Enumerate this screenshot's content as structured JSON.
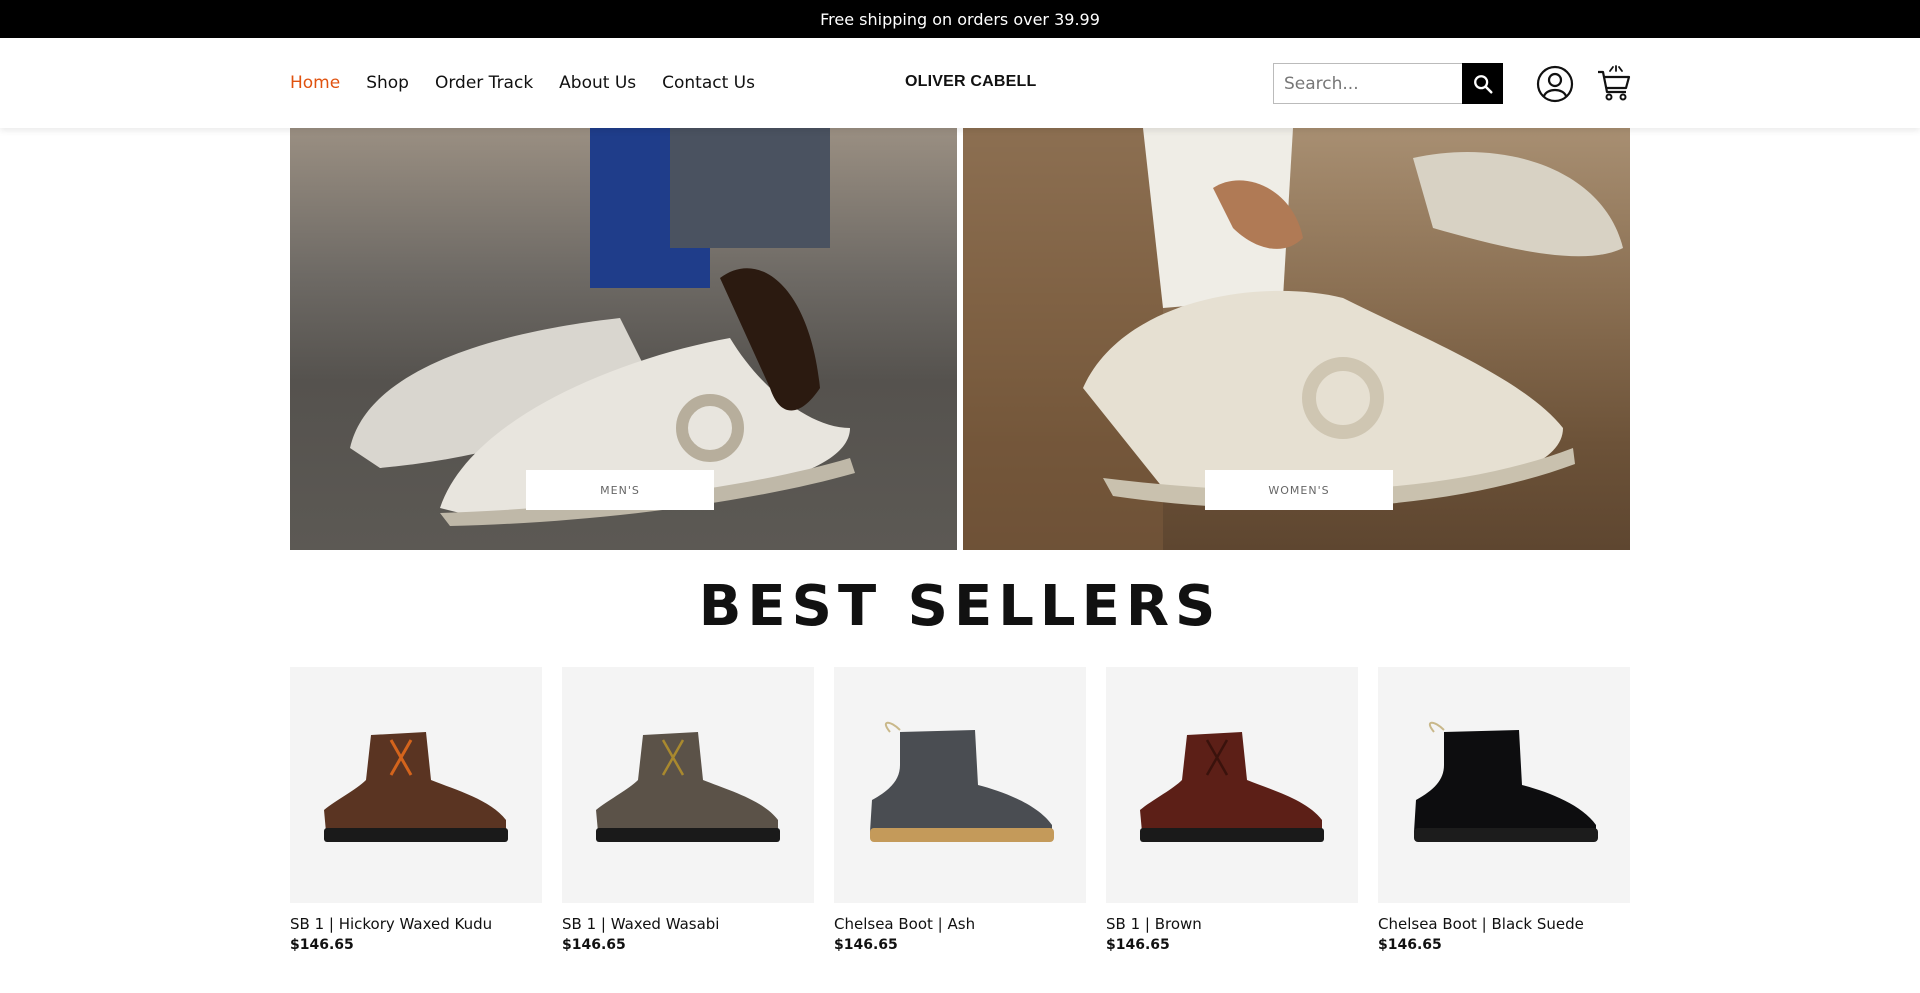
{
  "topbar": {
    "text": "Free shipping on orders over 39.99"
  },
  "nav": [
    {
      "label": "Home",
      "active": true
    },
    {
      "label": "Shop"
    },
    {
      "label": "Order Track"
    },
    {
      "label": "About Us"
    },
    {
      "label": "Contact Us"
    }
  ],
  "brand": {
    "logo": "OLIVER CABELL"
  },
  "search": {
    "placeholder": "Search..."
  },
  "colors": {
    "accent": "#e0520f",
    "topbar_bg": "#000000",
    "card_bg": "#f4f4f4"
  },
  "icons": {
    "search": "search-icon",
    "account": "user-icon",
    "cart": "cart-icon"
  },
  "hero": {
    "men_button": "MEN'S",
    "women_button": "WOMEN'S"
  },
  "best_sellers": {
    "title": "BEST SELLERS",
    "products": [
      {
        "name": "SB 1 | Hickory Waxed Kudu",
        "price": "$146.65"
      },
      {
        "name": "SB 1 | Waxed Wasabi",
        "price": "$146.65"
      },
      {
        "name": "Chelsea Boot | Ash",
        "price": "$146.65"
      },
      {
        "name": "SB 1 | Brown",
        "price": "$146.65"
      },
      {
        "name": "Chelsea Boot | Black Suede",
        "price": "$146.65"
      }
    ]
  }
}
